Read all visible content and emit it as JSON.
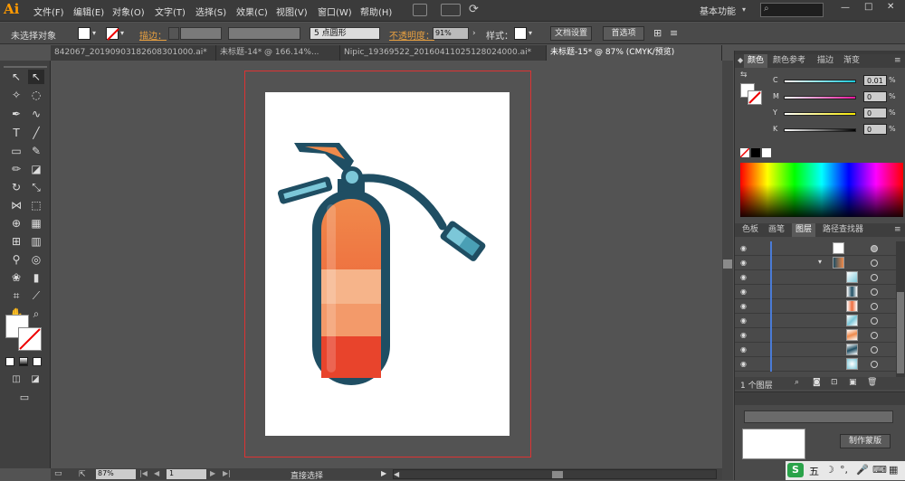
{
  "app": {
    "logo": "Ai"
  },
  "menu": [
    "文件(F)",
    "编辑(E)",
    "对象(O)",
    "文字(T)",
    "选择(S)",
    "效果(C)",
    "视图(V)",
    "窗口(W)",
    "帮助(H)"
  ],
  "workspace": {
    "label": "基本功能",
    "search_placeholder": ""
  },
  "control": {
    "selection": "未选择对象",
    "stroke_label": "描边：",
    "brush_value": "5 点圆形",
    "opacity_label": "不透明度：",
    "opacity_value": "91%",
    "style_label": "样式：",
    "doc_setup": "文档设置",
    "preferences": "首选项"
  },
  "tabs": [
    "842067_20190903182608301000.ai*",
    "未标题-14* @ 166.14%...",
    "Nipic_19369522_20160411025128024000.ai*",
    "未标题-15* @ 87% (CMYK/预览)"
  ],
  "status": {
    "zoom": "87%",
    "page": "1",
    "tool": "直接选择"
  },
  "color_panel": {
    "tabs": [
      "颜色",
      "颜色参考",
      "描边",
      "渐变"
    ],
    "channels": [
      {
        "name": "C",
        "value": "0.01",
        "color": "#19c7d8"
      },
      {
        "name": "M",
        "value": "0",
        "color": "#e6149b"
      },
      {
        "name": "Y",
        "value": "0",
        "color": "#f3e500"
      },
      {
        "name": "K",
        "value": "0",
        "color": "#000000"
      }
    ],
    "unit": "%"
  },
  "layers_panel": {
    "tabs": [
      "色板",
      "画笔",
      "图层",
      "路径查找器"
    ],
    "footer": "1 个图层",
    "buttons": [
      "制作蒙版"
    ]
  },
  "taskbar": {
    "ime": "五"
  },
  "extinguisher": {
    "body_top": "#f08a4b",
    "body_mid": "#f6b48a",
    "body_bottom": "#e8442c",
    "outline": "#1f4e63",
    "nozzle": "#7cc7d8"
  }
}
